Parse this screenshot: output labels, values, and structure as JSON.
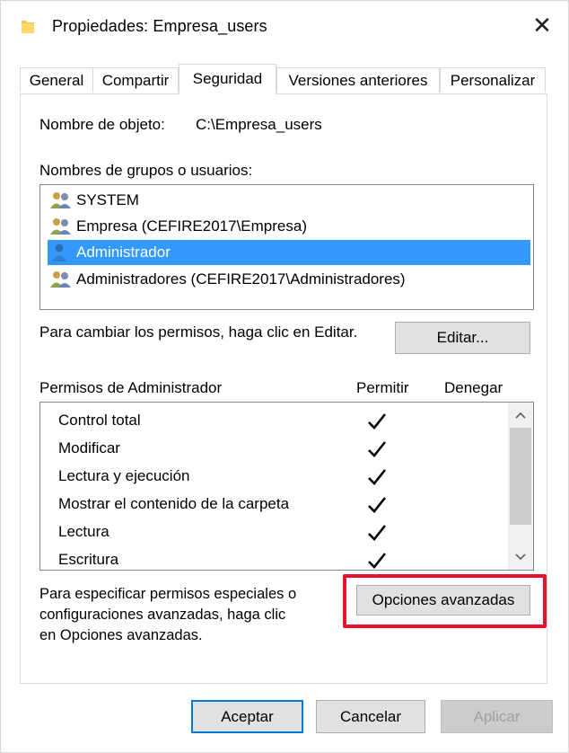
{
  "window": {
    "title": "Propiedades: Empresa_users",
    "close_glyph": "✕"
  },
  "tabs": [
    {
      "label": "General"
    },
    {
      "label": "Compartir"
    },
    {
      "label": "Seguridad",
      "active": true
    },
    {
      "label": "Versiones anteriores"
    },
    {
      "label": "Personalizar"
    }
  ],
  "security": {
    "object_name_label": "Nombre de objeto:",
    "object_name_value": "C:\\Empresa_users",
    "groups_label": "Nombres de grupos o usuarios:",
    "groups": [
      {
        "name": "SYSTEM",
        "icon": "user-group-icon"
      },
      {
        "name": "Empresa (CEFIRE2017\\Empresa)",
        "icon": "user-group-icon"
      },
      {
        "name": "Administrador",
        "icon": "user-icon",
        "selected": true
      },
      {
        "name": "Administradores (CEFIRE2017\\Administradores)",
        "icon": "user-group-icon"
      }
    ],
    "change_permissions_text": "Para cambiar los permisos, haga clic en Editar.",
    "edit_button": "Editar...",
    "permissions_label": "Permisos de Administrador",
    "allow_header": "Permitir",
    "deny_header": "Denegar",
    "permissions": [
      {
        "name": "Control total",
        "allow": true,
        "deny": false
      },
      {
        "name": "Modificar",
        "allow": true,
        "deny": false
      },
      {
        "name": "Lectura y ejecución",
        "allow": true,
        "deny": false
      },
      {
        "name": "Mostrar el contenido de la carpeta",
        "allow": true,
        "deny": false
      },
      {
        "name": "Lectura",
        "allow": true,
        "deny": false
      },
      {
        "name": "Escritura",
        "allow": true,
        "deny": false
      }
    ],
    "advanced_text_line1": "Para especificar permisos especiales o",
    "advanced_text_line2": "configuraciones avanzadas, haga clic",
    "advanced_text_line3": "en Opciones avanzadas.",
    "advanced_button": "Opciones avanzadas",
    "highlight_color": "#e8102a"
  },
  "footer": {
    "accept": "Aceptar",
    "cancel": "Cancelar",
    "apply": "Aplicar"
  },
  "colors": {
    "selection": "#3399ff",
    "default_button_border": "#0078d7"
  }
}
